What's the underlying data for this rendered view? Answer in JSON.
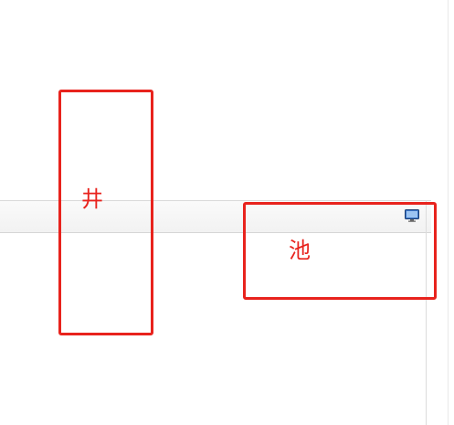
{
  "annotations": {
    "vertical_label": "井",
    "horizontal_label": "池",
    "color": "#e8231d"
  },
  "toolbar": {
    "icon": "monitor-icon"
  }
}
